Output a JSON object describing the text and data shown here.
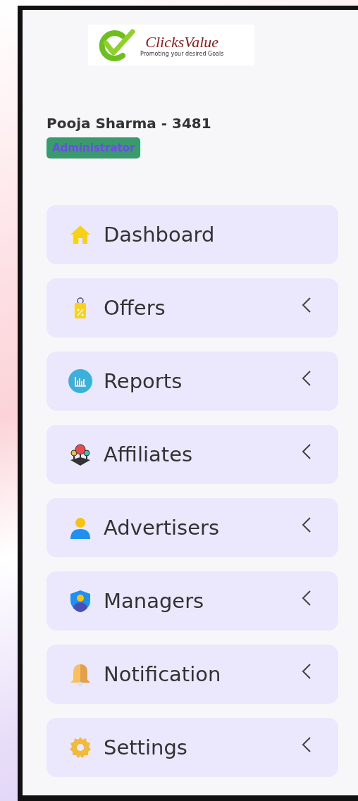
{
  "logo": {
    "name": "ClicksValue",
    "tagline": "Promoting your desired Goals"
  },
  "user": {
    "name": "Pooja Sharma - 3481",
    "role": "Administrator"
  },
  "menu": [
    {
      "label": "Dashboard",
      "kind": "link"
    },
    {
      "label": "Offers",
      "kind": "submenu",
      "expanded": false
    },
    {
      "label": "Reports",
      "kind": "submenu",
      "expanded": false
    },
    {
      "label": "Affiliates",
      "kind": "submenu",
      "expanded": false
    },
    {
      "label": "Advertisers",
      "kind": "submenu",
      "expanded": false
    },
    {
      "label": "Managers",
      "kind": "submenu",
      "expanded": false
    },
    {
      "label": "Notification",
      "kind": "submenu",
      "expanded": false
    },
    {
      "label": "Settings",
      "kind": "submenu",
      "expanded": false
    }
  ]
}
